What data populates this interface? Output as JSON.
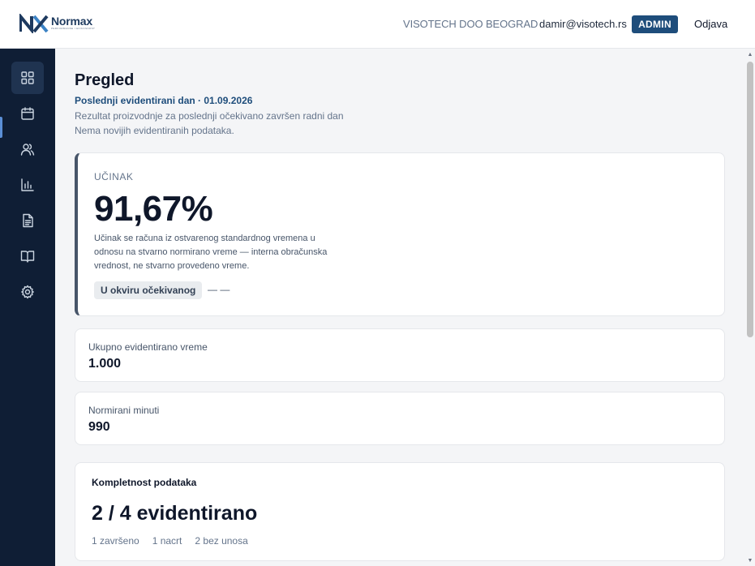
{
  "header": {
    "logo_name": "Normax",
    "logo_tagline": "PERFORMANSE I EFIKASNOST",
    "company": "VISOTECH DOO BEOGRAD",
    "email": "damir@visotech.rs",
    "role": "ADMIN",
    "logout": "Odjava"
  },
  "sidebar": {
    "items": [
      {
        "icon": "dashboard-grid-icon",
        "active": true
      },
      {
        "icon": "calendar-icon",
        "active": false
      },
      {
        "icon": "users-icon",
        "active": false
      },
      {
        "icon": "bar-chart-icon",
        "active": false
      },
      {
        "icon": "document-icon",
        "active": false
      },
      {
        "icon": "book-icon",
        "active": false
      },
      {
        "icon": "gear-icon",
        "active": false
      }
    ]
  },
  "page": {
    "title": "Pregled",
    "last_day": "Poslednji evidentirani dan · 01.09.2026",
    "subtitle": "Rezultat proizvodnje za poslednji očekivano završen radni dan",
    "note": "Nema novijih evidentiranih podataka."
  },
  "efficiency": {
    "label": "UČINAK",
    "value": "91,67%",
    "description": "Učinak se računa iz ostvarenog standardnog vremena u odnosu na stvarno normirano vreme — interna obračunska vrednost, ne stvarno provedeno vreme.",
    "status": "U okviru očekivanog",
    "dash": "— —"
  },
  "stats": [
    {
      "label": "Ukupno evidentirano vreme",
      "value": "1.000"
    },
    {
      "label": "Normirani minuti",
      "value": "990"
    }
  ],
  "completeness": {
    "title": "Kompletnost podataka",
    "value": "2 / 4 evidentirano",
    "meta": [
      "1 završeno",
      "1 nacrt",
      "2 bez unosa"
    ]
  },
  "colors": {
    "sidebar_bg": "#0f1e35",
    "accent": "#1e4d7b"
  }
}
